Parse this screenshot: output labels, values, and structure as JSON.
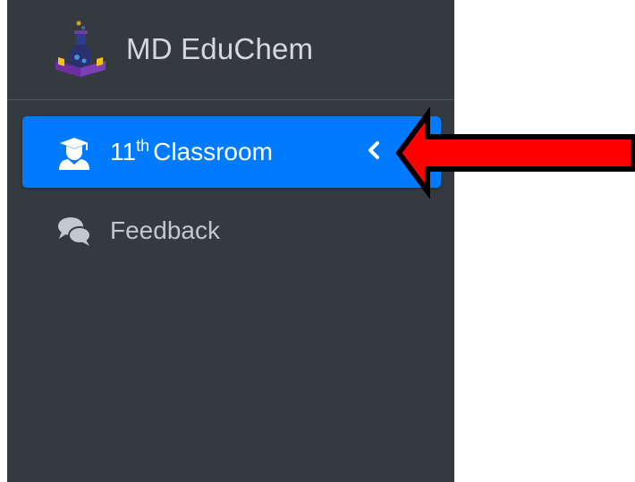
{
  "brand": {
    "name": "MD EduChem",
    "logo_icon": "flask-on-book-icon"
  },
  "nav": {
    "items": [
      {
        "label_main": "11",
        "label_sup": "th",
        "label_rest": "Classroom",
        "icon": "user-graduate-icon",
        "active": true,
        "expand_icon": "chevron-left-icon"
      },
      {
        "label": "Feedback",
        "icon": "comments-icon",
        "active": false
      }
    ]
  },
  "colors": {
    "sidebar_bg": "#343a40",
    "active_bg": "#007bff",
    "text_muted": "#c2c7d0",
    "annotation_arrow": "#ff0000"
  }
}
